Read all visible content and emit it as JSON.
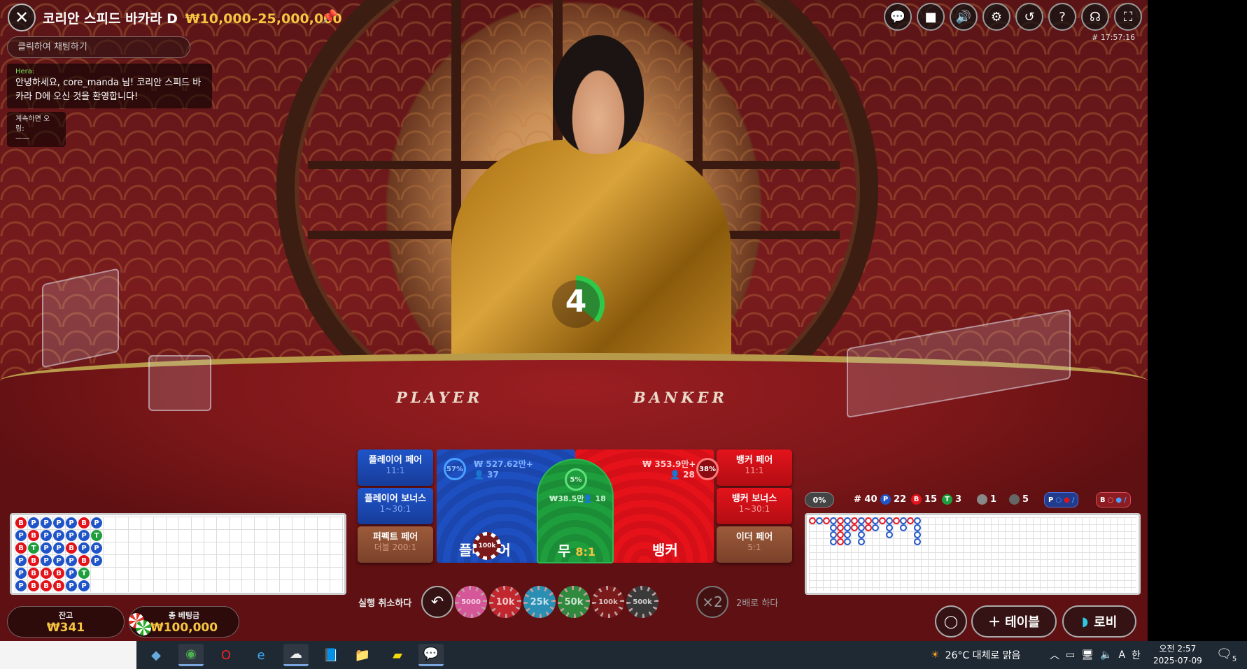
{
  "header": {
    "close_icon": "close-icon",
    "title": "코리안 스피드 바카라 D",
    "limits": "₩10,000–25,000,000",
    "pin_icon": "pin-icon",
    "round_id": "# 17:57:16",
    "icons": [
      {
        "name": "chat-icon",
        "glyph": "💬"
      },
      {
        "name": "video-icon",
        "glyph": "■"
      },
      {
        "name": "volume-icon",
        "glyph": "🔊"
      },
      {
        "name": "settings-icon",
        "glyph": "⚙"
      },
      {
        "name": "history-icon",
        "glyph": "↺"
      },
      {
        "name": "help-icon",
        "glyph": "?"
      },
      {
        "name": "support-icon",
        "glyph": "☊"
      },
      {
        "name": "fullscreen-icon",
        "glyph": "⛶"
      }
    ]
  },
  "chat": {
    "placeholder": "클릭하여 채팅하기",
    "sender": "Hera:",
    "message": "안녕하세요, core_manda 님! 코리안 스피드 바카라 D에 오신 것을 환영합니다!",
    "note_label": "계속하면 오링:",
    "note_value": "——"
  },
  "table": {
    "player_label": "PLAYER",
    "banker_label": "BANKER"
  },
  "timer": {
    "value": "4"
  },
  "bets": {
    "player_pair": {
      "label": "플레이어 페어",
      "odds": "11:1"
    },
    "player_bonus": {
      "label": "플레이어 보너스",
      "odds": "1~30:1"
    },
    "perfect_pair": {
      "label": "퍼펙트 페어",
      "odds": "더블 200:1"
    },
    "banker_pair": {
      "label": "뱅커 페어",
      "odds": "11:1"
    },
    "banker_bonus": {
      "label": "뱅커 보너스",
      "odds": "1~30:1"
    },
    "either_pair": {
      "label": "이더 페어",
      "odds": "5:1"
    },
    "player": {
      "label": "플레이어",
      "percent": "57%",
      "amount": "₩ 527.62만+",
      "players": "37",
      "chip": "100k"
    },
    "banker": {
      "label": "뱅커",
      "percent": "38%",
      "amount": "₩ 353.9만+",
      "players": "28"
    },
    "tie": {
      "label": "무",
      "odds": "8:1",
      "percent": "5%",
      "amount": "₩38.5만",
      "players": "18"
    }
  },
  "controls": {
    "undo_label": "실행 취소하다",
    "undo_icon": "undo-icon",
    "double_symbol": "×2",
    "double_label": "2배로 하다",
    "chips": [
      {
        "label": "5000",
        "color": "#d6569a"
      },
      {
        "label": "10k",
        "color": "#c2262e"
      },
      {
        "label": "25k",
        "color": "#2b8fb3"
      },
      {
        "label": "50k",
        "color": "#2f8a3e"
      },
      {
        "label": "100k",
        "color": "#7a1a1a"
      },
      {
        "label": "500k",
        "color": "#3a3a3a"
      }
    ]
  },
  "balance": {
    "label": "잔고",
    "value": "₩341"
  },
  "total_bet": {
    "label": "총 베팅금",
    "value": "₩100,000"
  },
  "road_stats": {
    "percent": "0%",
    "round": "# 40",
    "player_count": "22",
    "banker_count": "15",
    "tie_count": "3",
    "player_pair_count": "1",
    "banker_pair_count": "5",
    "player_predict": "P",
    "banker_predict": "B"
  },
  "bead_road": [
    [
      "B",
      "P",
      "P",
      "P",
      "P",
      "B",
      "P"
    ],
    [
      "P",
      "B",
      "P",
      "P",
      "P",
      "P",
      "T"
    ],
    [
      "B",
      "T",
      "P",
      "P",
      "B",
      "P",
      "P"
    ],
    [
      "P",
      "B",
      "P",
      "P",
      "P",
      "B",
      "P"
    ],
    [
      "P",
      "B",
      "B",
      "B",
      "P",
      "T",
      ""
    ],
    [
      "P",
      "B",
      "B",
      "B",
      "P",
      "P",
      ""
    ]
  ],
  "buttons": {
    "table": "테이블",
    "lobby": "로비",
    "table_icon": "plus-icon",
    "lobby_icon": "lobby-icon",
    "loop_icon": "multi-table-icon"
  },
  "taskbar": {
    "weather": "26°C  대체로 맑음",
    "time": "오전 2:57",
    "date": "2025-07-09",
    "lang": "A",
    "ime": "한",
    "notif_count": "5"
  },
  "colors": {
    "player_blue": "#1f55c9",
    "banker_red": "#e3131b",
    "tie_green": "#1f9e3d",
    "accent_gold": "#f5c542"
  }
}
